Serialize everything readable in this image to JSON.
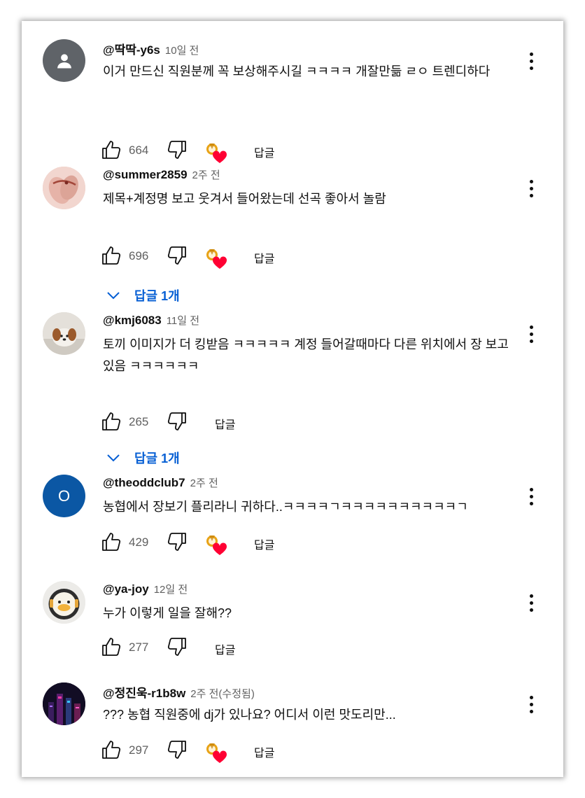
{
  "colors": {
    "link_blue": "#065fd4",
    "secondary_text": "#606060",
    "heart_red": "#ff0033",
    "avatar_gray": "#5f6368",
    "avatar_blue": "#0b57a4"
  },
  "comments": [
    {
      "author": "@딱딱-y6s",
      "time": "10일 전",
      "edited": "",
      "text": "이거 만드신 직원분께 꼭 보상해주시길 ㅋㅋㅋㅋ 개잘만듦 ㄹㅇ 트렌디하다",
      "likes": "664",
      "reply_label": "답글",
      "creator_heart": true,
      "avatar_icon": "person-icon"
    },
    {
      "author": "@summer2859",
      "time": "2주 전",
      "edited": "",
      "text": "제목+계정명 보고 웃겨서 들어왔는데 선곡 좋아서 놀람",
      "likes": "696",
      "reply_label": "답글",
      "creator_heart": true,
      "replies_label": "답글 1개",
      "avatar_icon": "photo-avatar-hands"
    },
    {
      "author": "@kmj6083",
      "time": "11일 전",
      "edited": "",
      "text": "토끼 이미지가 더 킹받음 ㅋㅋㅋㅋㅋ 계정 들어갈때마다 다른 위치에서 장 보고 있음 ㅋㅋㅋㅋㅋㅋ",
      "likes": "265",
      "reply_label": "답글",
      "creator_heart": false,
      "replies_label": "답글 1개",
      "avatar_icon": "photo-avatar-dog"
    },
    {
      "author": "@theoddclub7",
      "time": "2주 전",
      "edited": "",
      "text": "농협에서 장보기 플리라니 귀하다..ㅋㅋㅋㅋㄱㅋㅋㅋㅋㅋㅋㅋㅋㅋㅋㄱ",
      "likes": "429",
      "reply_label": "답글",
      "creator_heart": true,
      "avatar_letter": "O",
      "avatar_icon": "letter-avatar"
    },
    {
      "author": "@ya-joy",
      "time": "12일 전",
      "edited": "",
      "text": "누가 이렇게 일을 잘해??",
      "likes": "277",
      "reply_label": "답글",
      "creator_heart": false,
      "avatar_icon": "photo-avatar-duck"
    },
    {
      "author": "@정진욱-r1b8w",
      "time": "2주 전",
      "edited": "(수정됨)",
      "text": "??? 농협 직원중에 dj가 있나요? 어디서 이런 맛도리만...",
      "likes": "297",
      "reply_label": "답글",
      "creator_heart": true,
      "avatar_icon": "photo-avatar-neon-city"
    }
  ]
}
